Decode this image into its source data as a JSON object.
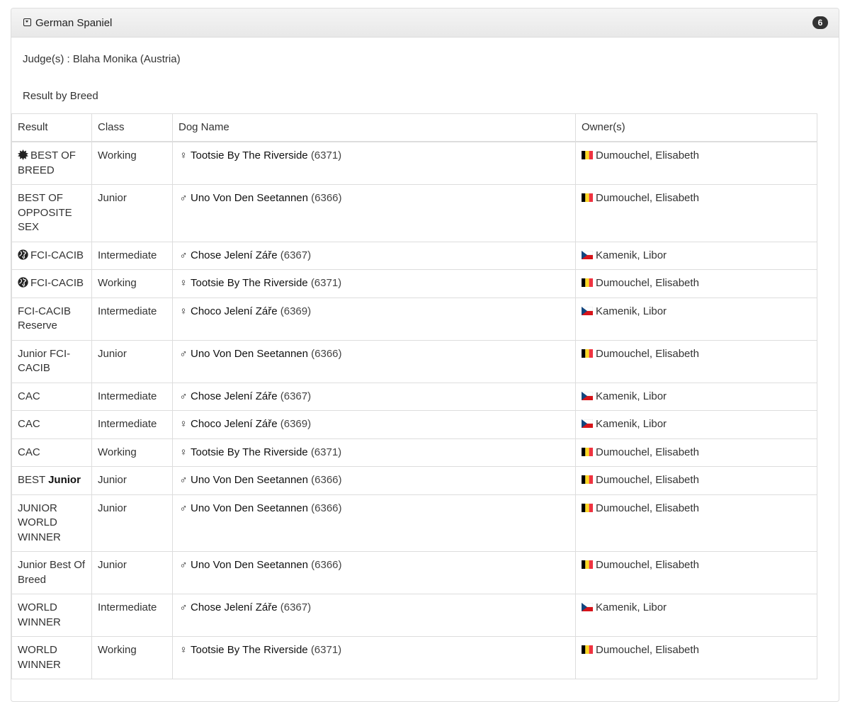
{
  "panel": {
    "breed": "German Spaniel",
    "count": "6",
    "judges": "Judge(s) : Blaha Monika (Austria)",
    "subtitle": "Result by Breed"
  },
  "table": {
    "headers": [
      "Result",
      "Class",
      "Dog Name",
      "Owner(s)"
    ],
    "rows": [
      {
        "result": "BEST OF BREED",
        "result_prefix": "",
        "result_bold": "",
        "award_icon": "star-burst-icon",
        "class": "Working",
        "sex": "female",
        "dog": "Tootsie By The Riverside",
        "id": "(6371)",
        "flag": "belgium-flag-icon",
        "owner": "Dumouchel, Elisabeth"
      },
      {
        "result": "BEST OF OPPOSITE SEX",
        "result_prefix": "",
        "result_bold": "",
        "award_icon": "",
        "class": "Junior",
        "sex": "male",
        "dog": "Uno Von Den Seetannen",
        "id": "(6366)",
        "flag": "belgium-flag-icon",
        "owner": "Dumouchel, Elisabeth"
      },
      {
        "result": "FCI-CACIB",
        "result_prefix": "",
        "result_bold": "",
        "award_icon": "globe-icon",
        "class": "Intermediate",
        "sex": "male",
        "dog": "Chose Jelení Záře",
        "id": "(6367)",
        "flag": "czech-flag-icon",
        "owner": "Kamenik, Libor"
      },
      {
        "result": "FCI-CACIB",
        "result_prefix": "",
        "result_bold": "",
        "award_icon": "globe-icon",
        "class": "Working",
        "sex": "female",
        "dog": "Tootsie By The Riverside",
        "id": "(6371)",
        "flag": "belgium-flag-icon",
        "owner": "Dumouchel, Elisabeth"
      },
      {
        "result": "FCI-CACIB Reserve",
        "result_prefix": "",
        "result_bold": "",
        "award_icon": "",
        "class": "Intermediate",
        "sex": "female",
        "dog": "Choco Jelení Záře",
        "id": "(6369)",
        "flag": "czech-flag-icon",
        "owner": "Kamenik, Libor"
      },
      {
        "result": "Junior FCI-CACIB",
        "result_prefix": "",
        "result_bold": "",
        "award_icon": "",
        "class": "Junior",
        "sex": "male",
        "dog": "Uno Von Den Seetannen",
        "id": "(6366)",
        "flag": "belgium-flag-icon",
        "owner": "Dumouchel, Elisabeth"
      },
      {
        "result": "CAC",
        "result_prefix": "",
        "result_bold": "",
        "award_icon": "",
        "class": "Intermediate",
        "sex": "male",
        "dog": "Chose Jelení Záře",
        "id": "(6367)",
        "flag": "czech-flag-icon",
        "owner": "Kamenik, Libor"
      },
      {
        "result": "CAC",
        "result_prefix": "",
        "result_bold": "",
        "award_icon": "",
        "class": "Intermediate",
        "sex": "female",
        "dog": "Choco Jelení Záře",
        "id": "(6369)",
        "flag": "czech-flag-icon",
        "owner": "Kamenik, Libor"
      },
      {
        "result": "CAC",
        "result_prefix": "",
        "result_bold": "",
        "award_icon": "",
        "class": "Working",
        "sex": "female",
        "dog": "Tootsie By The Riverside",
        "id": "(6371)",
        "flag": "belgium-flag-icon",
        "owner": "Dumouchel, Elisabeth"
      },
      {
        "result": "",
        "result_prefix": "BEST",
        "result_bold": "Junior",
        "award_icon": "",
        "class": "Junior",
        "sex": "male",
        "dog": "Uno Von Den Seetannen",
        "id": "(6366)",
        "flag": "belgium-flag-icon",
        "owner": "Dumouchel, Elisabeth"
      },
      {
        "result": "JUNIOR WORLD WINNER",
        "result_prefix": "",
        "result_bold": "",
        "award_icon": "",
        "class": "Junior",
        "sex": "male",
        "dog": "Uno Von Den Seetannen",
        "id": "(6366)",
        "flag": "belgium-flag-icon",
        "owner": "Dumouchel, Elisabeth"
      },
      {
        "result": "Junior Best Of Breed",
        "result_prefix": "",
        "result_bold": "",
        "award_icon": "",
        "class": "Junior",
        "sex": "male",
        "dog": "Uno Von Den Seetannen",
        "id": "(6366)",
        "flag": "belgium-flag-icon",
        "owner": "Dumouchel, Elisabeth"
      },
      {
        "result": "WORLD WINNER",
        "result_prefix": "",
        "result_bold": "",
        "award_icon": "",
        "class": "Intermediate",
        "sex": "male",
        "dog": "Chose Jelení Záře",
        "id": "(6367)",
        "flag": "czech-flag-icon",
        "owner": "Kamenik, Libor"
      },
      {
        "result": "WORLD WINNER",
        "result_prefix": "",
        "result_bold": "",
        "award_icon": "",
        "class": "Working",
        "sex": "female",
        "dog": "Tootsie By The Riverside",
        "id": "(6371)",
        "flag": "belgium-flag-icon",
        "owner": "Dumouchel, Elisabeth"
      }
    ]
  },
  "colors": {
    "belgium": [
      "#000000",
      "#FDDA24",
      "#EF3340"
    ],
    "czech": [
      "#FFFFFF",
      "#D7141A",
      "#11457E"
    ]
  }
}
